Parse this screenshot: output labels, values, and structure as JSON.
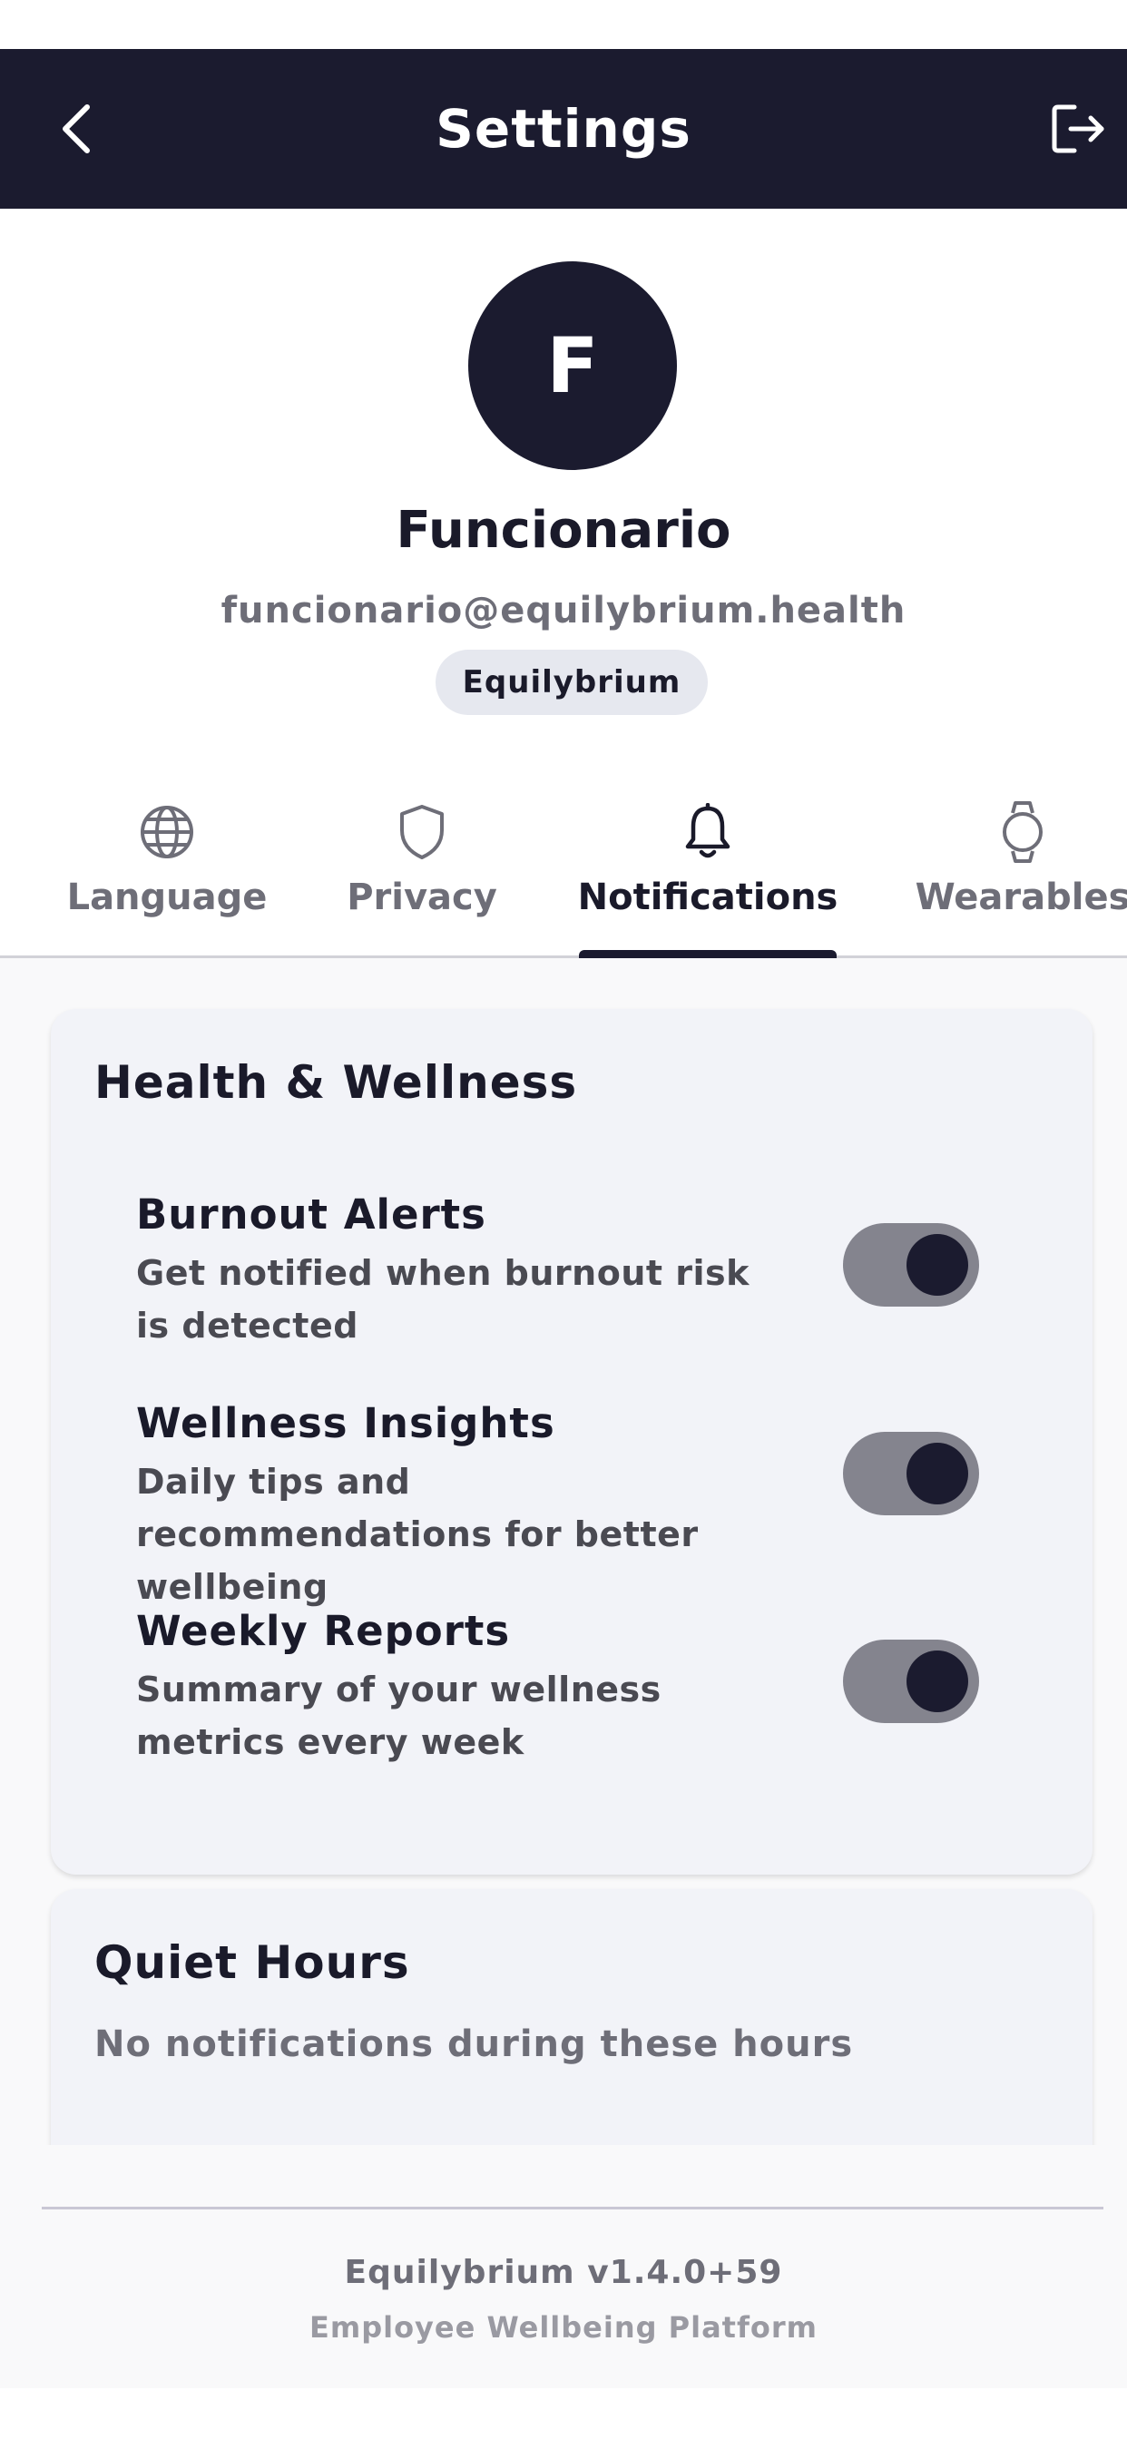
{
  "header": {
    "title": "Settings",
    "back_icon": "chevron-left-icon",
    "logout_icon": "logout-icon"
  },
  "profile": {
    "initial": "F",
    "name": "Funcionario",
    "email": "funcionario@equilybrium.health",
    "organization": "Equilybrium"
  },
  "tabs": [
    {
      "label": "Language",
      "icon": "globe-icon",
      "active": false
    },
    {
      "label": "Privacy",
      "icon": "shield-icon",
      "active": false
    },
    {
      "label": "Notifications",
      "icon": "bell-icon",
      "active": true
    },
    {
      "label": "Wearables",
      "icon": "watch-icon",
      "active": false
    }
  ],
  "health_wellness": {
    "title": "Health & Wellness",
    "items": [
      {
        "title": "Burnout Alerts",
        "description": "Get notified when burnout risk is detected",
        "enabled": true
      },
      {
        "title": "Wellness Insights",
        "description": "Daily tips and recommendations for better wellbeing",
        "enabled": true
      },
      {
        "title": "Weekly Reports",
        "description": "Summary of your wellness metrics every week",
        "enabled": true
      }
    ]
  },
  "quiet_hours": {
    "title": "Quiet Hours",
    "description": "No notifications during these hours"
  },
  "footer": {
    "version": "Equilybrium v1.4.0+59",
    "subtitle": "Employee Wellbeing Platform"
  },
  "colors": {
    "primary": "#1b1b2f",
    "toggle_track": "#84848e",
    "card_bg": "#f2f3f8",
    "badge_bg": "#e6e8ef"
  }
}
